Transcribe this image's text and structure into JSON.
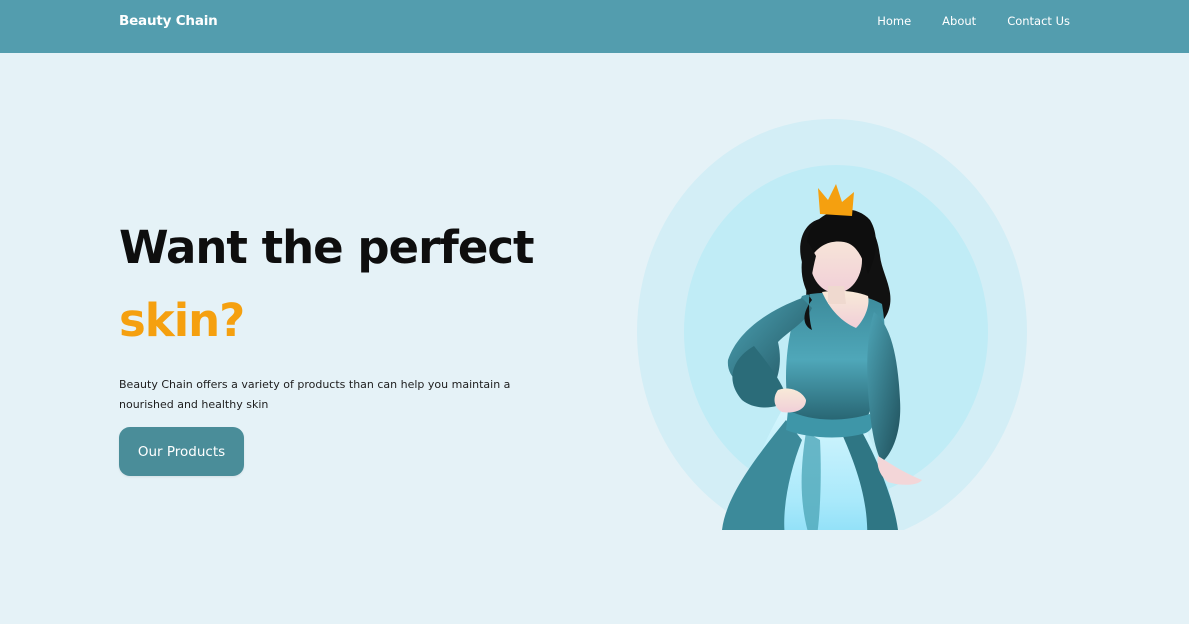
{
  "nav": {
    "brand": "Beauty Chain",
    "links": [
      {
        "label": "Home"
      },
      {
        "label": "About"
      },
      {
        "label": "Contact Us"
      }
    ]
  },
  "hero": {
    "headline": "Want the perfect",
    "headline_accent": "skin?",
    "description": "Beauty Chain offers a variety of products than can help you maintain a nourished and healthy skin",
    "cta_label": "Our Products"
  },
  "illustration": {
    "icon": "princess-illustration"
  },
  "colors": {
    "nav_bg": "#539dae",
    "page_bg": "#e5f2f7",
    "accent": "#f5a00f",
    "button_bg": "#4a8d99",
    "circle_outer": "#d3eef6",
    "circle_inner": "#c0ecf6"
  }
}
